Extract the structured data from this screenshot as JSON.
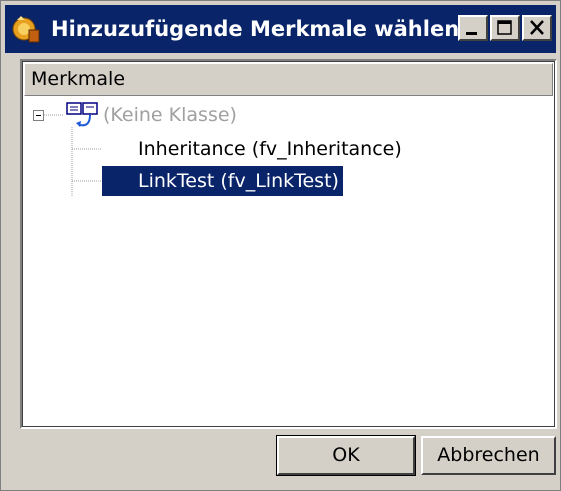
{
  "window": {
    "title": "Hinzuzufügende Merkmale wählen",
    "controls": {
      "minimize": "minimize-icon",
      "maximize": "maximize-icon",
      "close": "close-icon"
    }
  },
  "tree": {
    "column_header": "Merkmale",
    "root": {
      "label": "(Keine Klasse)",
      "expanded": true,
      "icon": "class-icon"
    },
    "children": [
      {
        "label": "Inheritance (fv_Inheritance)",
        "selected": false
      },
      {
        "label": "LinkTest (fv_LinkTest)",
        "selected": true
      }
    ]
  },
  "buttons": {
    "ok": "OK",
    "cancel": "Abbrechen"
  },
  "colors": {
    "titlebar": "#0a246a",
    "selection": "#0a246a",
    "face": "#d4d0c8"
  }
}
